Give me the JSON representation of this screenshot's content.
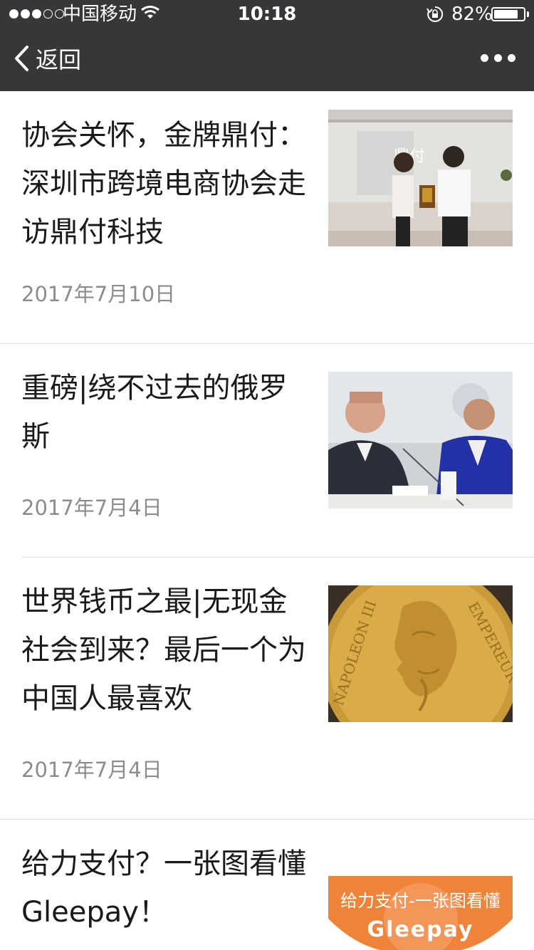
{
  "status_bar": {
    "carrier": "中国移动",
    "time": "10:18",
    "battery": "82%",
    "battery_level": 0.82,
    "signal_bars": 3
  },
  "nav": {
    "back_label": "返回",
    "more_icon": "ellipsis-icon",
    "back_icon": "chevron-left-icon"
  },
  "articles": [
    {
      "title": "协会关怀，金牌鼎付：深圳市跨境电商协会走访鼎付科技",
      "date": "2017年7月10日"
    },
    {
      "title": "重磅|绕不过去的俄罗斯",
      "date": "2017年7月4日"
    },
    {
      "title": "世界钱币之最|无现金社会到来？最后一个为中国人最喜欢",
      "date": "2017年7月4日"
    },
    {
      "title": "给力支付？一张图看懂Gleepay！",
      "thumb_text_top": "给力支付-一张图看懂",
      "thumb_text_bottom": "Gleepay"
    }
  ],
  "colors": {
    "topbar": "#37373a",
    "title_text": "#1a1a1a",
    "date_text": "#8c8c8c",
    "divider": "#e3e3e3",
    "gleepay_orange": "#f0833a"
  }
}
